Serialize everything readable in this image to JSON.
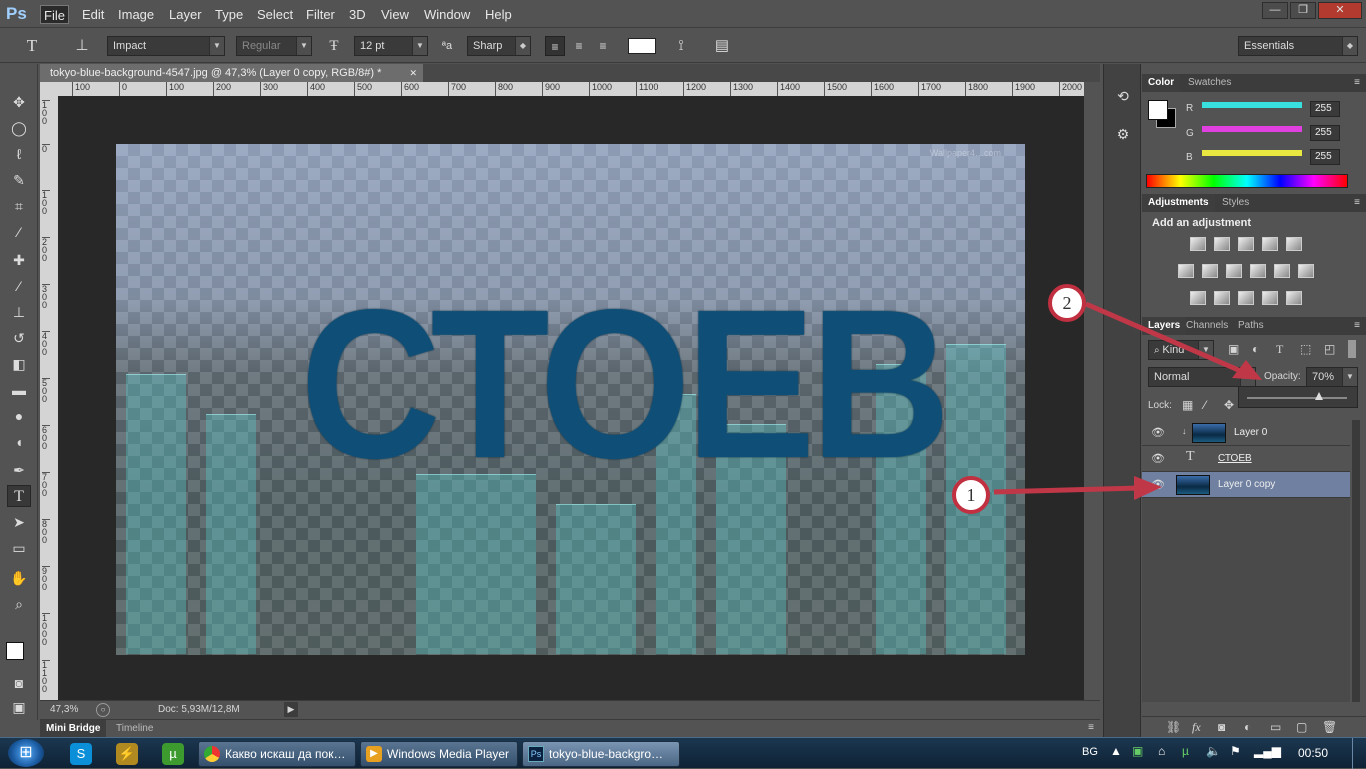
{
  "app": {
    "logo": "Ps"
  },
  "menu": [
    "File",
    "Edit",
    "Image",
    "Layer",
    "Type",
    "Select",
    "Filter",
    "3D",
    "View",
    "Window",
    "Help"
  ],
  "window_controls": {
    "minimize": "—",
    "restore": "❐",
    "close": "✕"
  },
  "options": {
    "font_family": "Impact",
    "font_style": "Regular",
    "font_size": "12 pt",
    "aa_icon": "ªa",
    "antialias": "Sharp",
    "workspace": "Essentials"
  },
  "document": {
    "tab_title": "tokyo-blue-background-4547.jpg @ 47,3% (Layer 0 copy, RGB/8#) *",
    "tab_close": "✕",
    "ruler_h": [
      "100",
      "0",
      "100",
      "200",
      "300",
      "400",
      "500",
      "600",
      "700",
      "800",
      "900",
      "1000",
      "1100",
      "1200",
      "1300",
      "1400",
      "1500",
      "1600",
      "1700",
      "1800",
      "1900",
      "2000"
    ],
    "ruler_v": [
      "100",
      "0",
      "100",
      "200",
      "300",
      "400",
      "500",
      "600",
      "700",
      "800",
      "900",
      "1000",
      "1100"
    ],
    "big_text": "СТОЕВ",
    "watermark": "Wallpaper4…com",
    "zoom": "47,3%",
    "doc_info": "Doc: 5,93M/12,8M"
  },
  "bottom_tabs": [
    "Mini Bridge",
    "Timeline"
  ],
  "color_panel": {
    "tabs": [
      "Color",
      "Swatches"
    ],
    "channels": [
      {
        "label": "R",
        "value": "255",
        "color": "#38e0e0"
      },
      {
        "label": "G",
        "value": "255",
        "color": "#e040e0"
      },
      {
        "label": "B",
        "value": "255",
        "color": "#e8e840"
      }
    ]
  },
  "adjustments_panel": {
    "tabs": [
      "Adjustments",
      "Styles"
    ],
    "heading": "Add an adjustment"
  },
  "layers_panel": {
    "tabs": [
      "Layers",
      "Channels",
      "Paths"
    ],
    "filter_kind": "Kind",
    "blend_mode": "Normal",
    "opacity_label": "Opacity:",
    "opacity_value": "70%",
    "lock_label": "Lock:",
    "layers": [
      {
        "name": "Layer 0",
        "type": "image",
        "selected": false
      },
      {
        "name": "СТОЕВ",
        "type": "text",
        "selected": false,
        "icon": "T"
      },
      {
        "name": "Layer 0 copy",
        "type": "image",
        "selected": true
      }
    ]
  },
  "annotations": [
    {
      "label": "1"
    },
    {
      "label": "2"
    }
  ],
  "taskbar": {
    "start": "⊞",
    "items": [
      {
        "label": "Какво искаш да пок…"
      },
      {
        "label": "Windows Media Player"
      },
      {
        "label": "tokyo-blue-backgro…"
      }
    ],
    "lang": "BG",
    "time": "00:50"
  }
}
